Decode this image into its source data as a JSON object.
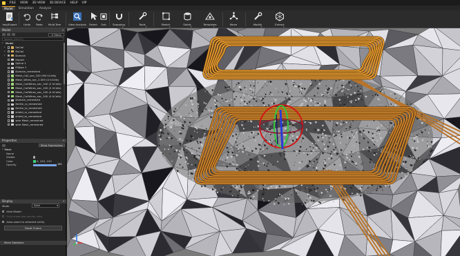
{
  "menu": {
    "items": [
      "FILE",
      "VIEW",
      "3D VIEW",
      "3D DEVICE",
      "HELP",
      "VIP"
    ]
  },
  "tabs": [
    {
      "label": "Model",
      "active": true
    },
    {
      "label": "Simulation",
      "active": false
    },
    {
      "label": "Analysis",
      "active": false
    }
  ],
  "ribbon": [
    {
      "label": "Imp/Export",
      "icon": "import-export-icon"
    },
    {
      "label": "Undo",
      "icon": "undo-icon"
    },
    {
      "label": "Redo",
      "icon": "redo-icon"
    },
    {
      "label": "Multi-Tree",
      "icon": "multi-tree-icon"
    },
    {
      "label": "View Analysis",
      "icon": "view-analysis-icon"
    },
    {
      "label": "Select",
      "icon": "select-icon"
    },
    {
      "label": "Sub",
      "icon": "sub-icon"
    },
    {
      "label": "Snapping",
      "icon": "magnet-icon"
    },
    {
      "label": "Tools",
      "icon": "wrench-icon"
    },
    {
      "label": "Sketch",
      "icon": "sketch-icon"
    },
    {
      "label": "Solids",
      "icon": "solids-icon"
    },
    {
      "label": "Templates",
      "icon": "templates-icon"
    },
    {
      "label": "Move",
      "icon": "move-icon"
    },
    {
      "label": "Modify",
      "icon": "modify-icon"
    },
    {
      "label": "Extract",
      "icon": "extract-icon"
    }
  ],
  "model_panel": {
    "title": "Model",
    "filters_label": "Filters",
    "search_placeholder": "Search (Ctrl+F)",
    "root_label": "Model",
    "items": [
      {
        "label": "SoCoil",
        "kind": "folder",
        "level": 1
      },
      {
        "label": "RxCoil",
        "kind": "folder",
        "level": 1
      },
      {
        "label": "Domain",
        "kind": "folder",
        "level": 1
      },
      {
        "label": "Import",
        "kind": "object",
        "level": 1
      },
      {
        "label": "Spline 1",
        "kind": "object",
        "level": 1
      },
      {
        "label": "Ellipse 1",
        "kind": "object",
        "level": 1
      },
      {
        "label": "Domain_remeshed",
        "kind": "object",
        "level": 1
      },
      {
        "label": "Mesh_Coil_sec_100 (M4 hCells)",
        "kind": "mesh",
        "level": 1
      },
      {
        "label": "Mesh_Wires_sec_2.005 (4 hCells)",
        "kind": "mesh",
        "level": 1
      },
      {
        "label": "Mesh_CoilWires_sec_100 (2 hCells)",
        "kind": "mesh",
        "level": 1
      },
      {
        "label": "Mesh_CoilWires_sec_100 (2 hCells)",
        "kind": "mesh",
        "level": 1
      },
      {
        "label": "Mesh_CoilWires_sec_100 (4 hCells)",
        "kind": "mesh",
        "level": 1
      },
      {
        "label": "Mesh_CoilWires_sec_100 (4 hCells)",
        "kind": "mesh",
        "level": 1
      },
      {
        "label": "Domain_remeshed",
        "kind": "object",
        "level": 1
      },
      {
        "label": "ferrite_rx_remeshed",
        "kind": "object",
        "level": 1
      },
      {
        "label": "ferrite_tx_remeshed",
        "kind": "object",
        "level": 1
      },
      {
        "label": "shield_rx_remeshed",
        "kind": "object",
        "level": 1
      },
      {
        "label": "shield_tx_remeshed",
        "kind": "object",
        "level": 1
      },
      {
        "label": "wire Mesh_remeshed",
        "kind": "object",
        "level": 1
      },
      {
        "label": "wire Mesh_remeshed",
        "kind": "object",
        "level": 1
      }
    ]
  },
  "properties_panel": {
    "title": "Properties",
    "show_expressions_label": "Show Expressions",
    "group_label": "Mesh",
    "rows": [
      {
        "label": "Name",
        "value": ""
      },
      {
        "label": "Visible",
        "value": ""
      },
      {
        "label": "Color",
        "value": "0, 240, 150"
      },
      {
        "label": "Opacity",
        "value": "100"
      }
    ]
  },
  "display_panel": {
    "title": "Display",
    "mode_label": "Mode",
    "mode_value": "Solid",
    "hide_model_label": "Hide Model",
    "only_show_label": "Only show two quality cells",
    "auto_zoom_label": "Auto-zoom to selected entity",
    "reset_button_label": "Reset Frame",
    "stats_label": "Mesh Statistics"
  },
  "colors": {
    "accent": "#f0a020",
    "coil": "#c9822a",
    "mesh_light": "#d6d6d6",
    "mesh_dark": "#2a2a2a",
    "selection_red": "#d01818",
    "selection_green": "#2ecc40",
    "selection_blue": "#2a3ad8"
  }
}
